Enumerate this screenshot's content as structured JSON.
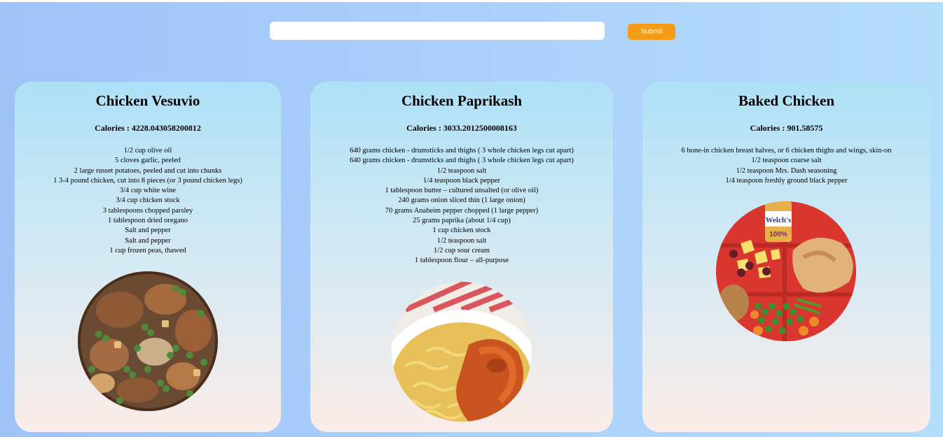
{
  "search": {
    "value": "",
    "placeholder": ""
  },
  "submit_label": "Submit",
  "recipes": [
    {
      "title": "Chicken Vesuvio",
      "calories": "Calories : 4228.043058200812",
      "ingredients": [
        "1/2 cup olive oil",
        "5 cloves garlic, peeled",
        "2 large russet potatoes, peeled and cut into chunks",
        "1 3-4 pound chicken, cut into 8 pieces (or 3 pound chicken legs)",
        "3/4 cup white wine",
        "3/4 cup chicken stock",
        "3 tablespoons chopped parsley",
        "1 tablespoon dried oregano",
        "Salt and pepper",
        "Salt and pepper",
        "1 cup frozen peas, thawed"
      ]
    },
    {
      "title": "Chicken Paprikash",
      "calories": "Calories : 3033.2012500008163",
      "ingredients": [
        "640 grams chicken - drumsticks and thighs ( 3 whole chicken legs cut apart)",
        "640 grams chicken - drumsticks and thighs ( 3 whole chicken legs cut apart)",
        "1/2 teaspoon salt",
        "1/4 teaspoon black pepper",
        "1 tablespoon butter – cultured unsalted (or olive oil)",
        "240 grams onion sliced thin (1 large onion)",
        "70 grams Anaheim pepper chopped (1 large pepper)",
        "25 grams paprika (about 1/4 cup)",
        "1 cup chicken stock",
        "1/2 teaspoon salt",
        "1/2 cup sour cream",
        "1 tablespoon flour – all-purpose"
      ]
    },
    {
      "title": "Baked Chicken",
      "calories": "Calories : 901.58575",
      "ingredients": [
        "6 bone-in chicken breast halves, or 6 chicken thighs and wings, skin-on",
        "1/2 teaspoon coarse salt",
        "1/2 teaspoon Mrs. Dash seasoning",
        "1/4 teaspoon freshly ground black pepper"
      ],
      "image_text": [
        "Welch's",
        "100%"
      ]
    }
  ],
  "colors": {
    "accent": "#f49c18",
    "card_top": "#aee1f7",
    "card_bottom": "#fbece8",
    "page_left": "#9fc3f7",
    "page_right": "#b4dcfb"
  }
}
